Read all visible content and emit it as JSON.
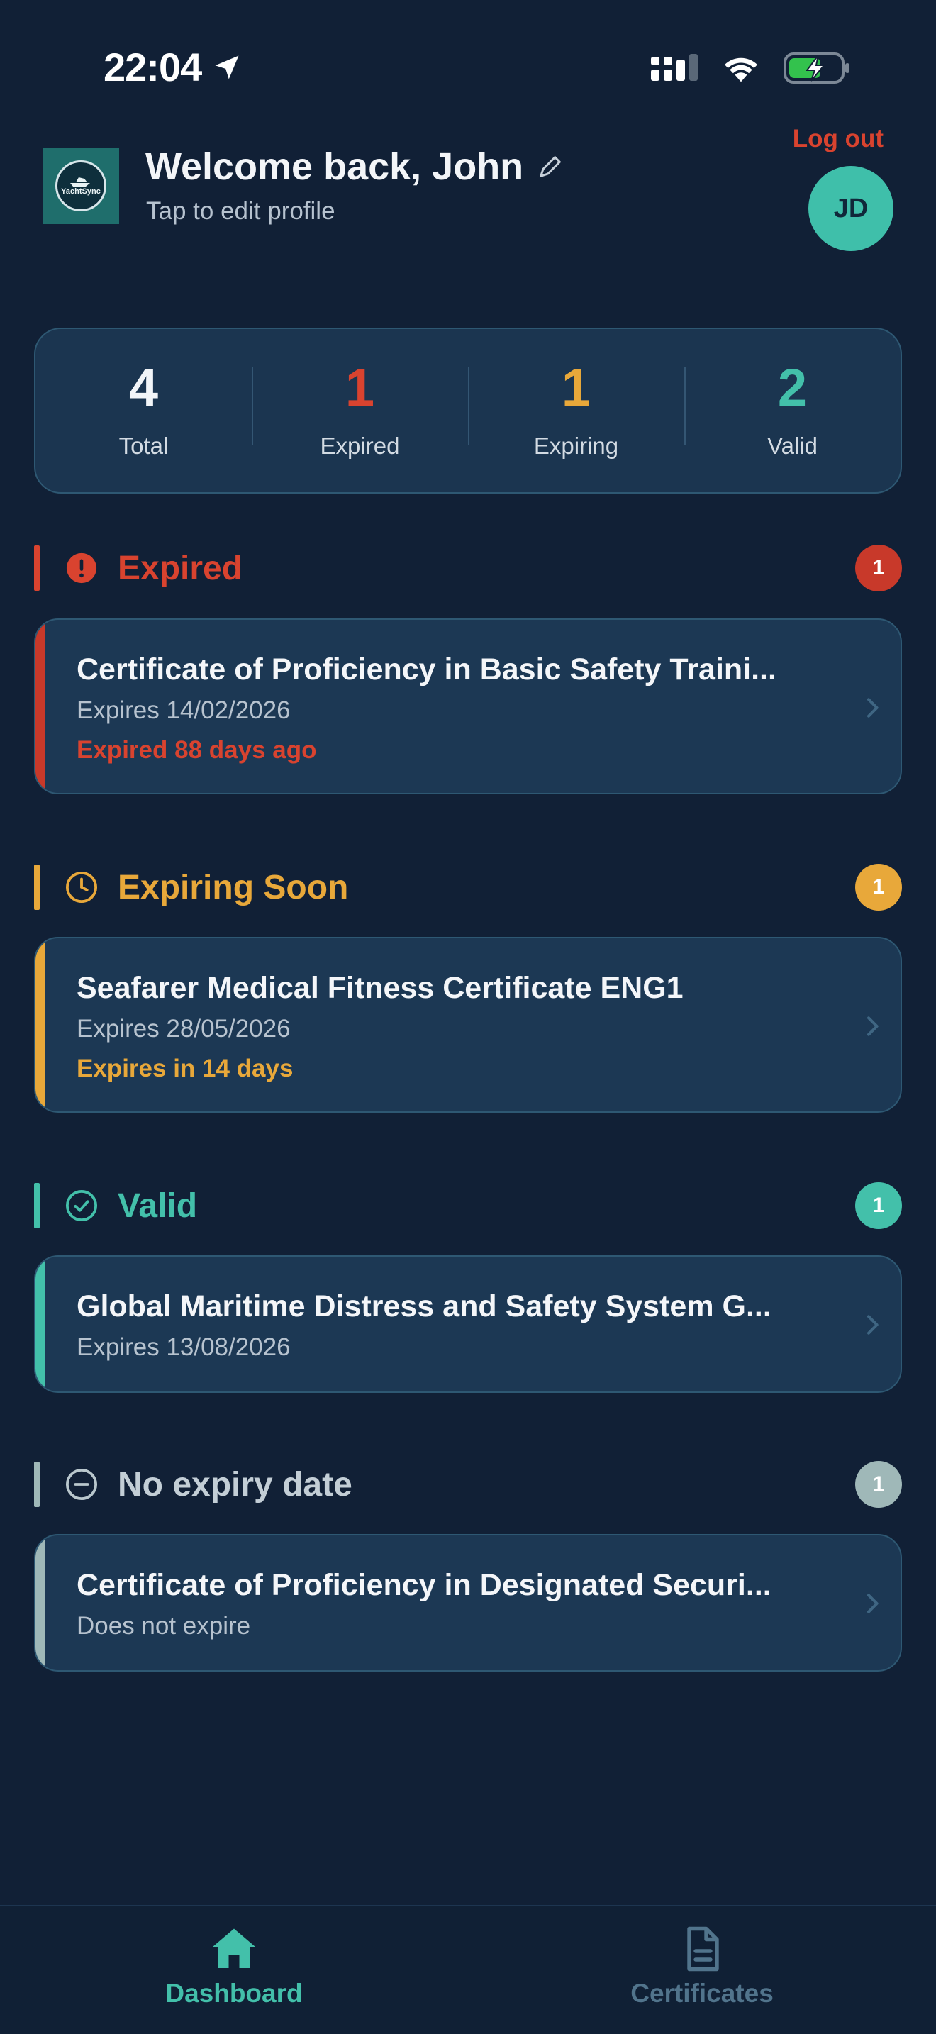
{
  "status_bar": {
    "time": "22:04"
  },
  "header": {
    "logo_text": "YachtSync",
    "welcome": "Welcome back, John",
    "subtitle": "Tap to edit profile",
    "logout_label": "Log out",
    "avatar_initials": "JD"
  },
  "stats": [
    {
      "value": "4",
      "label": "Total",
      "color": "#f2f5f8"
    },
    {
      "value": "1",
      "label": "Expired",
      "color": "#d9432f"
    },
    {
      "value": "1",
      "label": "Expiring",
      "color": "#e8a83a"
    },
    {
      "value": "2",
      "label": "Valid",
      "color": "#43c0aa"
    }
  ],
  "sections": {
    "expired": {
      "title": "Expired",
      "count": "1",
      "color": "#d9432f",
      "certificate": {
        "title": "Certificate of Proficiency in Basic Safety Traini...",
        "expires": "Expires 14/02/2026",
        "status": "Expired 88 days ago"
      }
    },
    "expiring": {
      "title": "Expiring Soon",
      "count": "1",
      "color": "#e8a83a",
      "certificate": {
        "title": "Seafarer Medical Fitness Certificate ENG1",
        "expires": "Expires 28/05/2026",
        "status": "Expires in 14 days"
      }
    },
    "valid": {
      "title": "Valid",
      "count": "1",
      "color": "#43c0aa",
      "certificate": {
        "title": "Global Maritime Distress and Safety System G...",
        "expires": "Expires 13/08/2026"
      }
    },
    "no_expiry": {
      "title": "No expiry date",
      "count": "1",
      "color": "#9fb8b8",
      "certificate": {
        "title": "Certificate of Proficiency in Designated Securi...",
        "expires": "Does not expire"
      }
    }
  },
  "bottom_nav": {
    "items": [
      {
        "label": "Dashboard",
        "icon": "home-icon",
        "active": true
      },
      {
        "label": "Certificates",
        "icon": "document-icon",
        "active": false
      }
    ]
  }
}
